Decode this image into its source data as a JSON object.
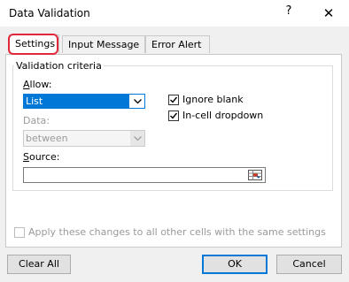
{
  "window": {
    "title": "Data Validation",
    "help_label": "?",
    "close_label": "✕"
  },
  "tabs": [
    {
      "label": "Settings"
    },
    {
      "label": "Input Message"
    },
    {
      "label": "Error Alert"
    }
  ],
  "criteria": {
    "legend": "Validation criteria",
    "allow_label": "Allow:",
    "allow_value": "List",
    "data_label": "Data:",
    "data_value": "between",
    "ignore_blank_label": "Ignore blank",
    "ignore_blank_checked": true,
    "dropdown_label": "In-cell dropdown",
    "dropdown_checked": true,
    "source_label": "Source:",
    "source_value": ""
  },
  "apply_all_label": "Apply these changes to all other cells with the same settings",
  "buttons": {
    "clear_all": "Clear All",
    "ok": "OK",
    "cancel": "Cancel"
  },
  "colors": {
    "highlight": "#e0283a",
    "accent": "#0078d7"
  },
  "icons": {
    "range_selector": "range-select-icon",
    "dropdown": "chevron-down-icon"
  }
}
